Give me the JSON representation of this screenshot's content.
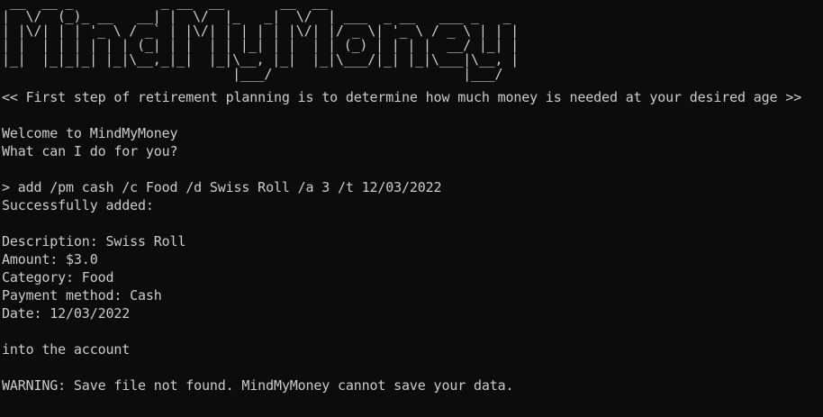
{
  "banner": {
    "art": " __  __ _           _ __  __       __  __\n|  \\/  (_)_ __   __| |  \\/  |_   _|  \\/  | ___  _ __   ___ _   _\n| |\\/| | | '_ \\ / _` | |\\/| | | | | |\\/| |/ _ \\| '_ \\ / _ \\ | | |\n| |  | | | | | | (_| | |  | | |_| | |  | | (_) | | | |  __/ |_| |\n|_|  |_|_|_| |_|\\__,_|_|  |_|\\__, |_|  |_|\\___/|_| |_|\\___|\\__, |\n                             |___/                        |___/"
  },
  "output": {
    "tagline": "<< First step of retirement planning is to determine how much money is needed at your desired age >>",
    "welcome": "Welcome to MindMyMoney",
    "prompt_question": "What can I do for you?",
    "command": "> add /pm cash /c Food /d Swiss Roll /a 3 /t 12/03/2022",
    "success": "Successfully added:",
    "description": "Description: Swiss Roll",
    "amount": "Amount: $3.0",
    "category": "Category: Food",
    "payment_method": "Payment method: Cash",
    "date": "Date: 12/03/2022",
    "into_account": "into the account",
    "warning": "WARNING: Save file not found. MindMyMoney cannot save your data."
  }
}
